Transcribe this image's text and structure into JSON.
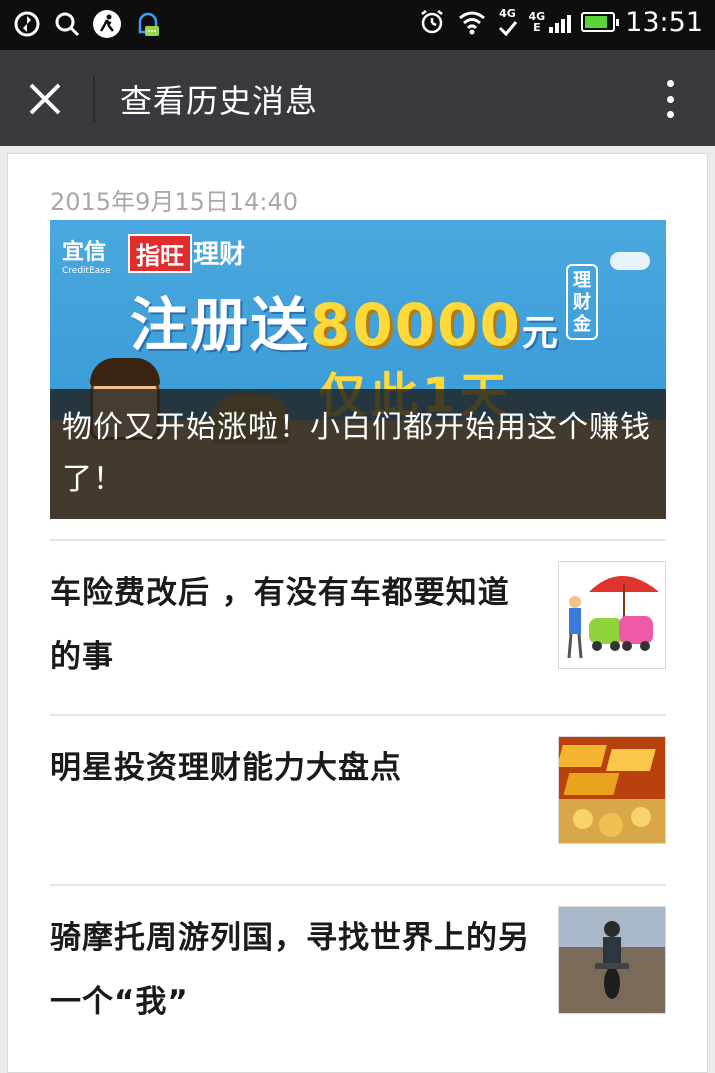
{
  "statusbar": {
    "time": "13:51",
    "net1": "4G",
    "net2": "4G",
    "net2_sub": "E"
  },
  "titlebar": {
    "title": "查看历史消息"
  },
  "message": {
    "date": "2015年9月15日14:40",
    "cover": {
      "ad_logo1": "宜信",
      "ad_logo1_sub": "CreditEase",
      "ad_logo2": "指旺",
      "ad_logo3": "理财",
      "ad_headline_a": "注册送",
      "ad_headline_num": "80000",
      "ad_headline_b": "元",
      "ad_badge": "理财金",
      "ad_sub": "仅此1天",
      "caption": "物价又开始涨啦！小白们都开始用这个赚钱了！"
    },
    "items": [
      {
        "title": "车险费改后 ，有没有车都要知道的事"
      },
      {
        "title": "明星投资理财能力大盘点"
      },
      {
        "title": "骑摩托周游列国，寻找世界上的另一个“我”"
      }
    ]
  }
}
